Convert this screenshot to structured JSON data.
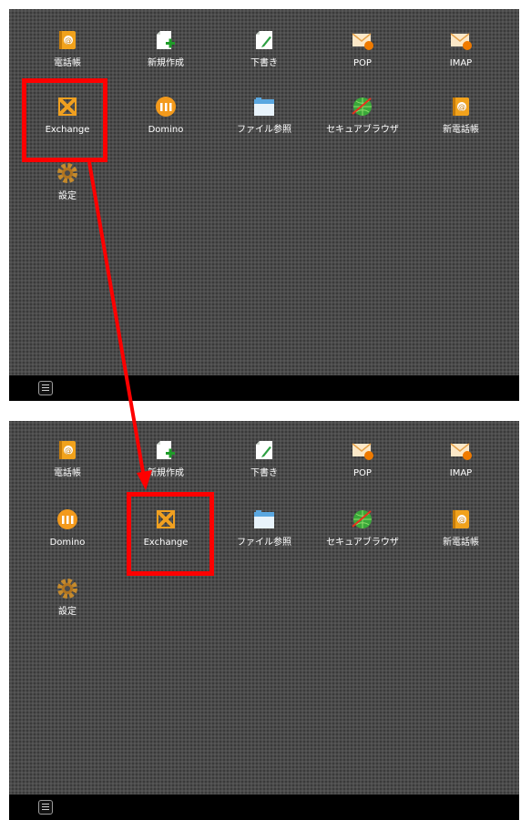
{
  "top_screen": {
    "apps": [
      {
        "label": "電話帳",
        "icon": "phonebook-icon"
      },
      {
        "label": "新規作成",
        "icon": "new-document-icon"
      },
      {
        "label": "下書き",
        "icon": "draft-icon"
      },
      {
        "label": "POP",
        "icon": "pop-mail-icon",
        "badge": "POP"
      },
      {
        "label": "IMAP",
        "icon": "imap-mail-icon",
        "badge": "IMAP"
      },
      {
        "label": "Exchange",
        "icon": "exchange-icon"
      },
      {
        "label": "Domino",
        "icon": "domino-icon"
      },
      {
        "label": "ファイル参照",
        "icon": "file-browse-icon"
      },
      {
        "label": "セキュアブラウザ",
        "icon": "secure-browser-icon"
      },
      {
        "label": "新電話帳",
        "icon": "new-phonebook-icon"
      },
      {
        "label": "設定",
        "icon": "settings-icon"
      }
    ]
  },
  "bottom_screen": {
    "apps": [
      {
        "label": "電話帳",
        "icon": "phonebook-icon"
      },
      {
        "label": "新規作成",
        "icon": "new-document-icon"
      },
      {
        "label": "下書き",
        "icon": "draft-icon"
      },
      {
        "label": "POP",
        "icon": "pop-mail-icon",
        "badge": "POP"
      },
      {
        "label": "IMAP",
        "icon": "imap-mail-icon",
        "badge": "IMAP"
      },
      {
        "label": "Domino",
        "icon": "domino-icon"
      },
      {
        "label": "Exchange",
        "icon": "exchange-icon"
      },
      {
        "label": "ファイル参照",
        "icon": "file-browse-icon"
      },
      {
        "label": "セキュアブラウザ",
        "icon": "secure-browser-icon"
      },
      {
        "label": "新電話帳",
        "icon": "new-phonebook-icon"
      },
      {
        "label": "設定",
        "icon": "settings-icon"
      }
    ]
  },
  "colors": {
    "screen_background": "#4b4b4b",
    "taskbar": "#000000",
    "highlight": "#ff0000",
    "label_text": "#ffffff"
  }
}
